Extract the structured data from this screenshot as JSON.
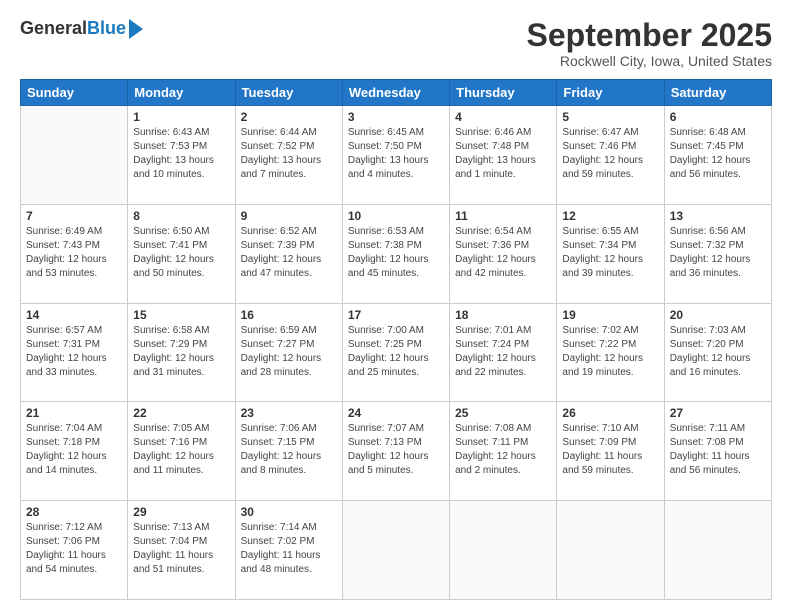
{
  "logo": {
    "general": "General",
    "blue": "Blue"
  },
  "header": {
    "month": "September 2025",
    "location": "Rockwell City, Iowa, United States"
  },
  "weekdays": [
    "Sunday",
    "Monday",
    "Tuesday",
    "Wednesday",
    "Thursday",
    "Friday",
    "Saturday"
  ],
  "days": [
    {
      "date": "",
      "info": ""
    },
    {
      "date": "1",
      "info": "Sunrise: 6:43 AM\nSunset: 7:53 PM\nDaylight: 13 hours\nand 10 minutes."
    },
    {
      "date": "2",
      "info": "Sunrise: 6:44 AM\nSunset: 7:52 PM\nDaylight: 13 hours\nand 7 minutes."
    },
    {
      "date": "3",
      "info": "Sunrise: 6:45 AM\nSunset: 7:50 PM\nDaylight: 13 hours\nand 4 minutes."
    },
    {
      "date": "4",
      "info": "Sunrise: 6:46 AM\nSunset: 7:48 PM\nDaylight: 13 hours\nand 1 minute."
    },
    {
      "date": "5",
      "info": "Sunrise: 6:47 AM\nSunset: 7:46 PM\nDaylight: 12 hours\nand 59 minutes."
    },
    {
      "date": "6",
      "info": "Sunrise: 6:48 AM\nSunset: 7:45 PM\nDaylight: 12 hours\nand 56 minutes."
    },
    {
      "date": "7",
      "info": "Sunrise: 6:49 AM\nSunset: 7:43 PM\nDaylight: 12 hours\nand 53 minutes."
    },
    {
      "date": "8",
      "info": "Sunrise: 6:50 AM\nSunset: 7:41 PM\nDaylight: 12 hours\nand 50 minutes."
    },
    {
      "date": "9",
      "info": "Sunrise: 6:52 AM\nSunset: 7:39 PM\nDaylight: 12 hours\nand 47 minutes."
    },
    {
      "date": "10",
      "info": "Sunrise: 6:53 AM\nSunset: 7:38 PM\nDaylight: 12 hours\nand 45 minutes."
    },
    {
      "date": "11",
      "info": "Sunrise: 6:54 AM\nSunset: 7:36 PM\nDaylight: 12 hours\nand 42 minutes."
    },
    {
      "date": "12",
      "info": "Sunrise: 6:55 AM\nSunset: 7:34 PM\nDaylight: 12 hours\nand 39 minutes."
    },
    {
      "date": "13",
      "info": "Sunrise: 6:56 AM\nSunset: 7:32 PM\nDaylight: 12 hours\nand 36 minutes."
    },
    {
      "date": "14",
      "info": "Sunrise: 6:57 AM\nSunset: 7:31 PM\nDaylight: 12 hours\nand 33 minutes."
    },
    {
      "date": "15",
      "info": "Sunrise: 6:58 AM\nSunset: 7:29 PM\nDaylight: 12 hours\nand 31 minutes."
    },
    {
      "date": "16",
      "info": "Sunrise: 6:59 AM\nSunset: 7:27 PM\nDaylight: 12 hours\nand 28 minutes."
    },
    {
      "date": "17",
      "info": "Sunrise: 7:00 AM\nSunset: 7:25 PM\nDaylight: 12 hours\nand 25 minutes."
    },
    {
      "date": "18",
      "info": "Sunrise: 7:01 AM\nSunset: 7:24 PM\nDaylight: 12 hours\nand 22 minutes."
    },
    {
      "date": "19",
      "info": "Sunrise: 7:02 AM\nSunset: 7:22 PM\nDaylight: 12 hours\nand 19 minutes."
    },
    {
      "date": "20",
      "info": "Sunrise: 7:03 AM\nSunset: 7:20 PM\nDaylight: 12 hours\nand 16 minutes."
    },
    {
      "date": "21",
      "info": "Sunrise: 7:04 AM\nSunset: 7:18 PM\nDaylight: 12 hours\nand 14 minutes."
    },
    {
      "date": "22",
      "info": "Sunrise: 7:05 AM\nSunset: 7:16 PM\nDaylight: 12 hours\nand 11 minutes."
    },
    {
      "date": "23",
      "info": "Sunrise: 7:06 AM\nSunset: 7:15 PM\nDaylight: 12 hours\nand 8 minutes."
    },
    {
      "date": "24",
      "info": "Sunrise: 7:07 AM\nSunset: 7:13 PM\nDaylight: 12 hours\nand 5 minutes."
    },
    {
      "date": "25",
      "info": "Sunrise: 7:08 AM\nSunset: 7:11 PM\nDaylight: 12 hours\nand 2 minutes."
    },
    {
      "date": "26",
      "info": "Sunrise: 7:10 AM\nSunset: 7:09 PM\nDaylight: 11 hours\nand 59 minutes."
    },
    {
      "date": "27",
      "info": "Sunrise: 7:11 AM\nSunset: 7:08 PM\nDaylight: 11 hours\nand 56 minutes."
    },
    {
      "date": "28",
      "info": "Sunrise: 7:12 AM\nSunset: 7:06 PM\nDaylight: 11 hours\nand 54 minutes."
    },
    {
      "date": "29",
      "info": "Sunrise: 7:13 AM\nSunset: 7:04 PM\nDaylight: 11 hours\nand 51 minutes."
    },
    {
      "date": "30",
      "info": "Sunrise: 7:14 AM\nSunset: 7:02 PM\nDaylight: 11 hours\nand 48 minutes."
    },
    {
      "date": "",
      "info": ""
    },
    {
      "date": "",
      "info": ""
    },
    {
      "date": "",
      "info": ""
    },
    {
      "date": "",
      "info": ""
    }
  ]
}
